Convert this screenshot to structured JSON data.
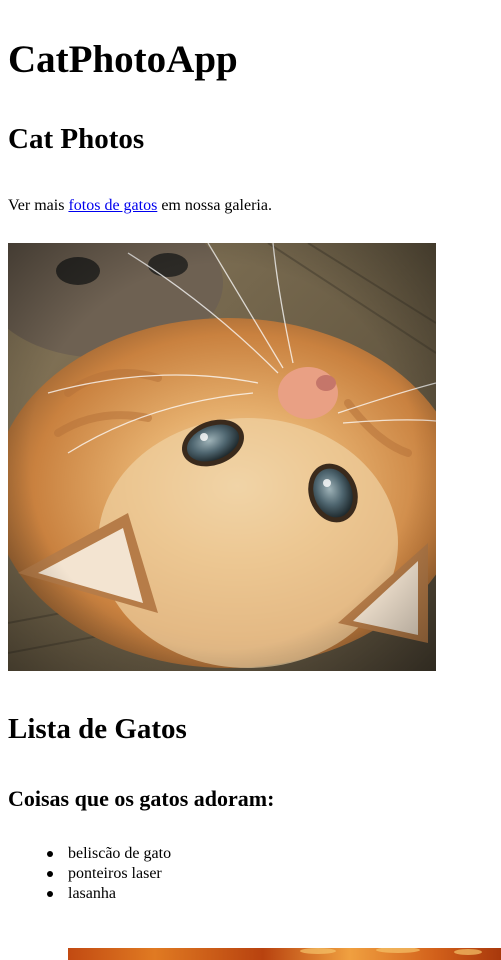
{
  "app": {
    "title": "CatPhotoApp"
  },
  "cat_photos_section": {
    "heading": "Cat Photos",
    "intro": {
      "prefix": "Ver mais ",
      "link_text": "fotos de gatos",
      "suffix": " em nossa galeria."
    },
    "image": {
      "subject": "orange kitten lying upside down on a wooden floor",
      "alt": "Um gatinho laranja deitado de costas no chão de madeira"
    }
  },
  "cat_list_section": {
    "heading": "Lista de Gatos",
    "subheading": "Coisas que os gatos adoram:",
    "items": [
      "beliscão de gato",
      "ponteiros laser",
      "lasanha"
    ],
    "image": {
      "subject": "lasagna (partially visible, cut off at bottom)"
    }
  },
  "colors": {
    "background": "#ffffff",
    "text": "#000000",
    "link": "#0000ee"
  }
}
